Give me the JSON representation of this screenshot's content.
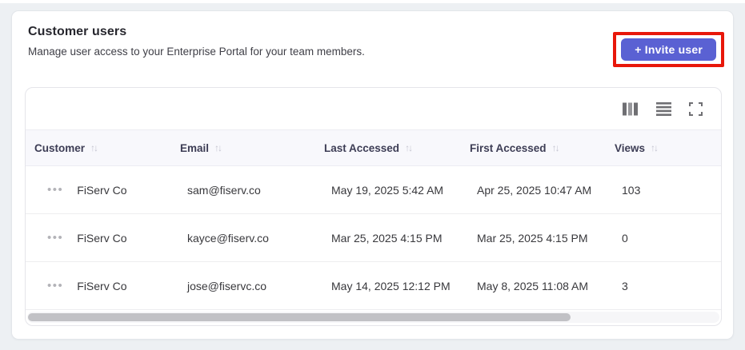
{
  "header": {
    "title": "Customer users",
    "subtitle": "Manage user access to your Enterprise Portal for your team members.",
    "invite_button_label": "+ Invite user"
  },
  "colors": {
    "accent_button": "#5a61d3",
    "annotation_highlight": "#e8170a",
    "table_header_bg": "#f8f8fc",
    "page_bg": "#edf0f3"
  },
  "toolbar": {
    "icons": [
      "columns-icon",
      "row-density-icon",
      "fullscreen-icon"
    ]
  },
  "table": {
    "sort_icon": "↑↓",
    "row_menu_icon": "•••",
    "columns": [
      {
        "label": "Customer"
      },
      {
        "label": "Email"
      },
      {
        "label": "Last Accessed"
      },
      {
        "label": "First Accessed"
      },
      {
        "label": "Views"
      }
    ],
    "rows": [
      {
        "customer": "FiServ Co",
        "email": "sam@fiserv.co",
        "last_accessed": "May 19, 2025 5:42 AM",
        "first_accessed": "Apr 25, 2025 10:47 AM",
        "views": "103"
      },
      {
        "customer": "FiServ Co",
        "email": "kayce@fiserv.co",
        "last_accessed": "Mar 25, 2025 4:15 PM",
        "first_accessed": "Mar 25, 2025 4:15 PM",
        "views": "0"
      },
      {
        "customer": "FiServ Co",
        "email": "jose@fiservc.co",
        "last_accessed": "May 14, 2025 12:12 PM",
        "first_accessed": "May 8, 2025 11:08 AM",
        "views": "3"
      }
    ]
  }
}
